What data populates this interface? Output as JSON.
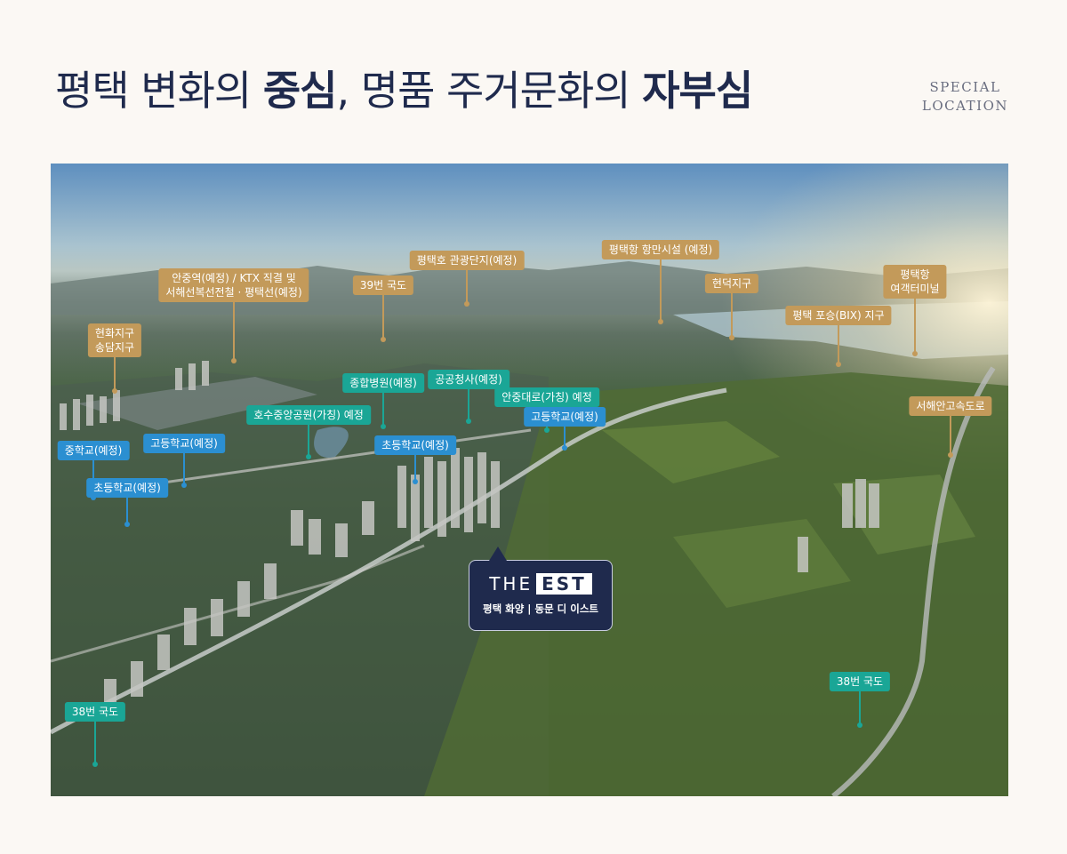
{
  "heading": {
    "line_a": "평택 변화의 ",
    "strong_a": "중심",
    "line_b": ", 명품 주거문화의 ",
    "strong_b": "자부심"
  },
  "tag": {
    "line1": "SPECIAL",
    "line2": "LOCATION"
  },
  "est": {
    "logo_left": "THE",
    "logo_right": "EST",
    "subtitle": "평택 화양 | 동문 디 이스트"
  },
  "colors": {
    "gold": "#c39a5a",
    "teal": "#1aa696",
    "blue": "#2b8fd1",
    "navy": "#1f2a4d"
  },
  "labels": [
    {
      "id": "anjung-station",
      "lines": [
        "안중역(예정) / KTX 직결 및",
        "서해선복선전철 · 평택선(예정)"
      ],
      "color": "gold"
    },
    {
      "id": "route39",
      "lines": [
        "39번 국도"
      ],
      "color": "gold"
    },
    {
      "id": "pyeongtaek-lake",
      "lines": [
        "평택호 관광단지(예정)"
      ],
      "color": "gold"
    },
    {
      "id": "port-facility",
      "lines": [
        "평택항 항만시설 (예정)"
      ],
      "color": "gold"
    },
    {
      "id": "hyeondeok",
      "lines": [
        "현덕지구"
      ],
      "color": "gold"
    },
    {
      "id": "ferry-terminal",
      "lines": [
        "평택항",
        "여객터미널"
      ],
      "color": "gold"
    },
    {
      "id": "poseung-bix",
      "lines": [
        "평택 포승(BIX) 지구"
      ],
      "color": "gold"
    },
    {
      "id": "hyeonhwa",
      "lines": [
        "현화지구",
        "송담지구"
      ],
      "color": "gold"
    },
    {
      "id": "seohaean-expressway",
      "lines": [
        "서해안고속도로"
      ],
      "color": "gold"
    },
    {
      "id": "general-hospital",
      "lines": [
        "종합병원(예정)"
      ],
      "color": "teal"
    },
    {
      "id": "public-office",
      "lines": [
        "공공청사(예정)"
      ],
      "color": "teal"
    },
    {
      "id": "anjung-daero",
      "lines": [
        "안중대로(가칭) 예정"
      ],
      "color": "teal"
    },
    {
      "id": "lake-park",
      "lines": [
        "호수중앙공원(가칭) 예정"
      ],
      "color": "teal"
    },
    {
      "id": "route38-left",
      "lines": [
        "38번 국도"
      ],
      "color": "teal"
    },
    {
      "id": "route38-right",
      "lines": [
        "38번 국도"
      ],
      "color": "teal"
    },
    {
      "id": "high-school-a",
      "lines": [
        "고등학교(예정)"
      ],
      "color": "blue"
    },
    {
      "id": "high-school-b",
      "lines": [
        "고등학교(예정)"
      ],
      "color": "blue"
    },
    {
      "id": "middle-school",
      "lines": [
        "중학교(예정)"
      ],
      "color": "blue"
    },
    {
      "id": "elementary-a",
      "lines": [
        "초등학교(예정)"
      ],
      "color": "blue"
    },
    {
      "id": "elementary-b",
      "lines": [
        "초등학교(예정)"
      ],
      "color": "blue"
    }
  ]
}
